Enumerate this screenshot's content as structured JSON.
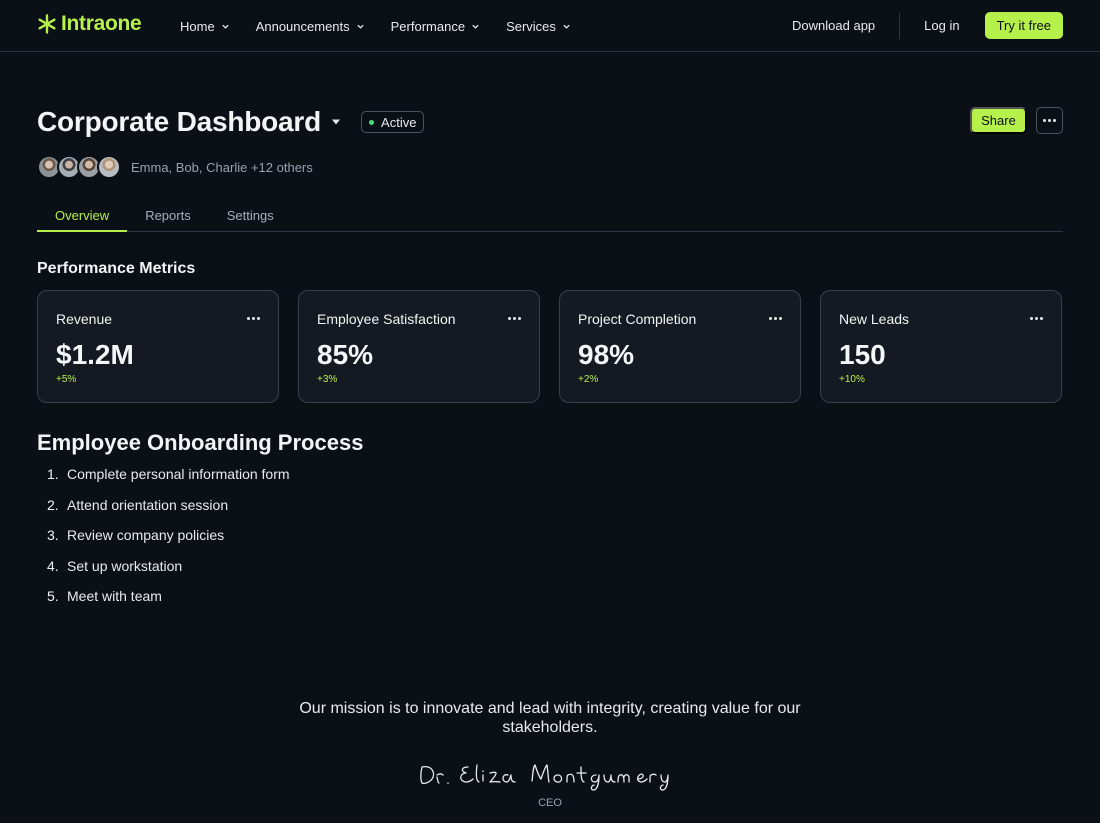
{
  "brand": {
    "name": "Intraone",
    "accent": "#b6f04b"
  },
  "nav": {
    "links": [
      {
        "label": "Home"
      },
      {
        "label": "Announcements"
      },
      {
        "label": "Performance"
      },
      {
        "label": "Services"
      }
    ],
    "download_label": "Download app",
    "login_label": "Log in",
    "cta_label": "Try it free"
  },
  "header": {
    "title": "Corporate Dashboard",
    "status": "Active",
    "share_label": "Share",
    "members_text": "Emma, Bob, Charlie",
    "members_more": "+12 others"
  },
  "tabs": [
    {
      "label": "Overview",
      "active": true
    },
    {
      "label": "Reports",
      "active": false
    },
    {
      "label": "Settings",
      "active": false
    }
  ],
  "metrics": {
    "title": "Performance Metrics",
    "cards": [
      {
        "label": "Revenue",
        "value": "$1.2M",
        "delta": "+5%"
      },
      {
        "label": "Employee Satisfaction",
        "value": "85%",
        "delta": "+3%"
      },
      {
        "label": "Project Completion",
        "value": "98%",
        "delta": "+2%"
      },
      {
        "label": "New Leads",
        "value": "150",
        "delta": "+10%"
      }
    ]
  },
  "onboarding": {
    "title": "Employee Onboarding Process",
    "steps": [
      {
        "num": "1.",
        "text": "Complete personal information form"
      },
      {
        "num": "2.",
        "text": "Attend orientation session"
      },
      {
        "num": "3.",
        "text": "Review company policies"
      },
      {
        "num": "4.",
        "text": "Set up workstation"
      },
      {
        "num": "5.",
        "text": "Meet with team"
      }
    ]
  },
  "mission": {
    "text": "Our mission is to innovate and lead with integrity, creating value for our stakeholders.",
    "signature": "Dr. Eliza Montgomery",
    "role": "CEO"
  }
}
